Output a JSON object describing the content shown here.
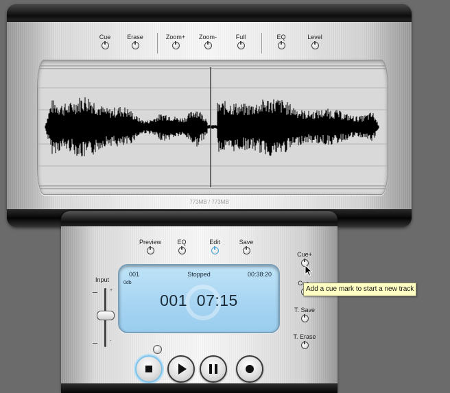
{
  "top_panel": {
    "buttons": [
      {
        "label": "Cue",
        "icon": "knob-icon"
      },
      {
        "label": "Erase",
        "icon": "knob-icon"
      },
      {
        "label": "Zoom+",
        "icon": "knob-icon"
      },
      {
        "label": "Zoom-",
        "icon": "knob-icon"
      },
      {
        "label": "Full",
        "icon": "knob-icon"
      },
      {
        "label": "EQ",
        "icon": "knob-icon"
      },
      {
        "label": "Level",
        "icon": "knob-icon"
      }
    ],
    "storage": "773MB / 773MB"
  },
  "bottom_panel": {
    "buttons": [
      {
        "label": "Preview",
        "icon": "knob-icon",
        "active": false
      },
      {
        "label": "EQ",
        "icon": "knob-icon",
        "active": false
      },
      {
        "label": "Edit",
        "icon": "knob-icon",
        "active": true
      },
      {
        "label": "Save",
        "icon": "knob-icon",
        "active": false
      }
    ],
    "input": {
      "label": "Input",
      "tick_plus": "+",
      "tick_minus": "-"
    },
    "display": {
      "track": "001",
      "level": "0db",
      "status": "Stopped",
      "elapsed": "00:38:20",
      "big_track": "001",
      "big_time": "07:15"
    },
    "transport": [
      {
        "name": "stop",
        "icon": "stop-icon",
        "active": true
      },
      {
        "name": "play",
        "icon": "play-icon",
        "active": false
      },
      {
        "name": "pause",
        "icon": "pause-icon",
        "active": false
      },
      {
        "name": "record",
        "icon": "record-icon",
        "active": false
      }
    ],
    "side_buttons": [
      {
        "label": "Cue+",
        "icon": "knob-icon"
      },
      {
        "label": "Cue-",
        "icon": "knob-icon"
      },
      {
        "label": "T. Save",
        "icon": "knob-icon"
      },
      {
        "label": "T. Erase",
        "icon": "knob-icon"
      }
    ]
  },
  "tooltip": {
    "text": "Add a cue mark to start a new track"
  },
  "colors": {
    "lcd": "#a6d4f2",
    "active_ring": "#4aa6d8",
    "tooltip_bg": "#fefec2",
    "waveform": "#000000"
  }
}
